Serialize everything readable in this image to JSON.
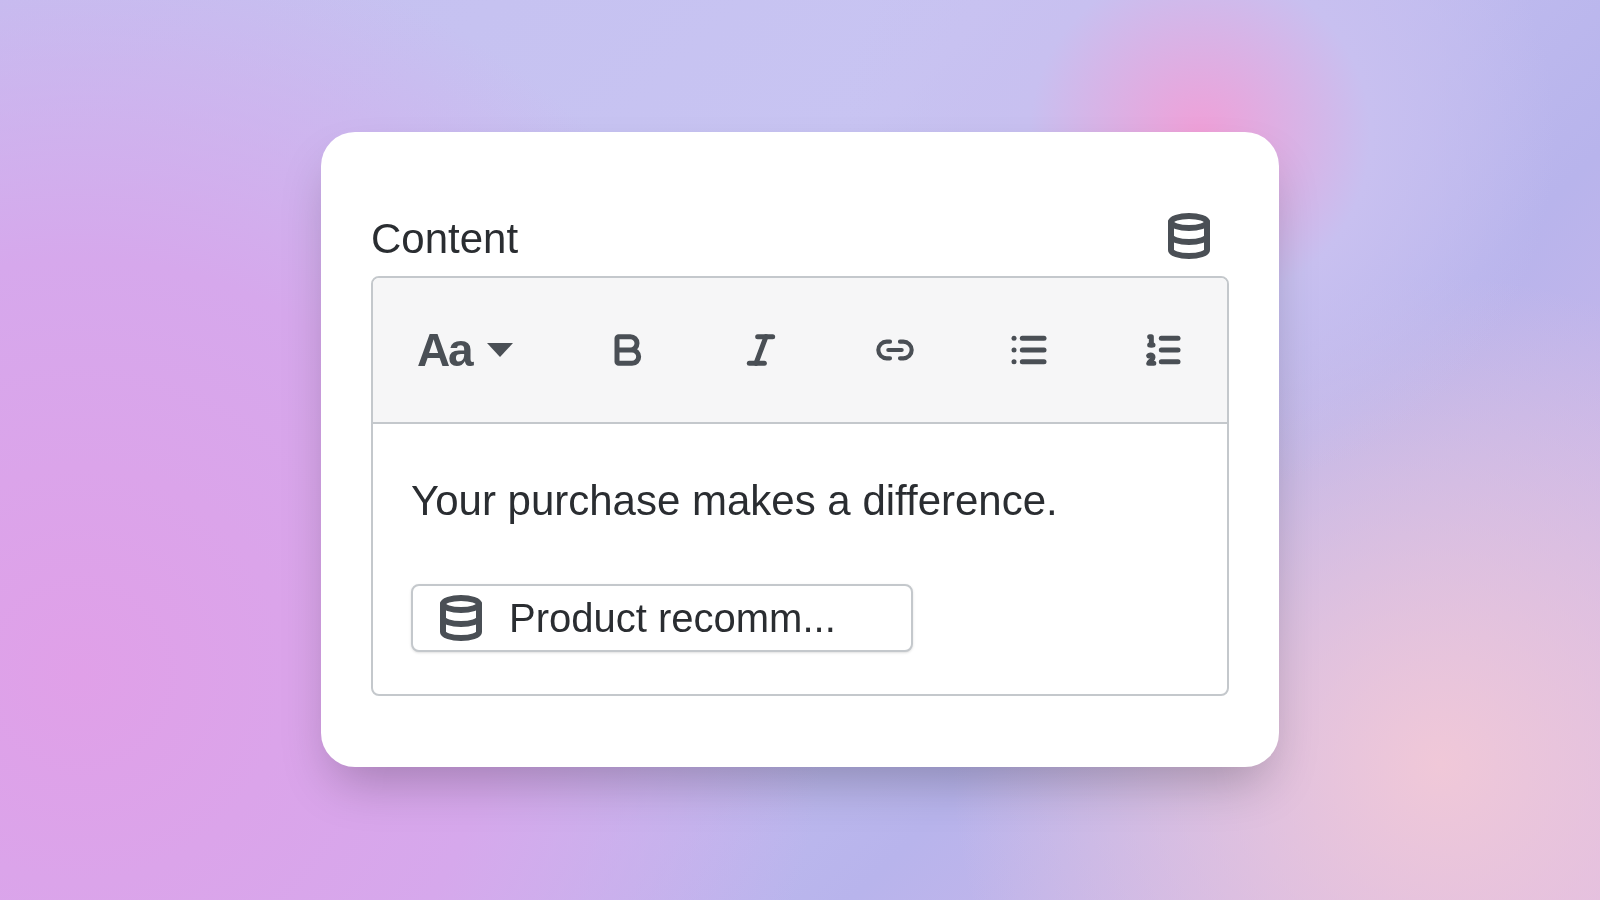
{
  "panel": {
    "title": "Content"
  },
  "toolbar": [
    {
      "kind": "font",
      "label": "Aa"
    },
    {
      "kind": "bold"
    },
    {
      "kind": "italic"
    },
    {
      "kind": "link"
    },
    {
      "kind": "bullets"
    },
    {
      "kind": "numbers"
    }
  ],
  "editor": {
    "text": "Your purchase makes a difference.",
    "chip": {
      "label": "Product recomm..."
    }
  }
}
